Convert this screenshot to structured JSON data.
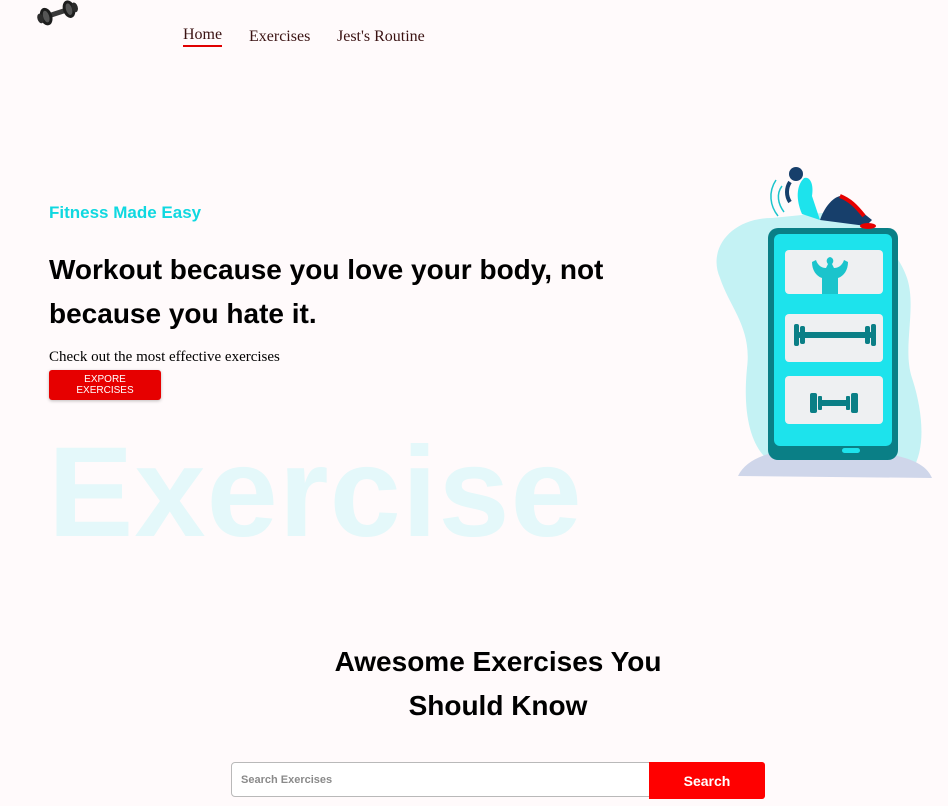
{
  "brand": {
    "logo_icon": "dumbbell-icon"
  },
  "nav": {
    "items": [
      {
        "label": "Home",
        "active": true
      },
      {
        "label": "Exercises"
      },
      {
        "label": "Jest's Routine"
      }
    ],
    "active_color": "#e00000"
  },
  "hero": {
    "tagline": "Fitness Made Easy",
    "headline": "Workout because you love your body, not because you hate it.",
    "subtext": "Check out the most effective exercises",
    "cta_label": "EXPORE EXERCISES",
    "watermark": "Exercise",
    "illustration_icon": "fitness-phone-illustration",
    "accent_color": "#10d8e0",
    "cta_color": "#e60000"
  },
  "exercises_section": {
    "title": "Awesome Exercises You Should Know"
  },
  "search": {
    "placeholder": "Search Exercises",
    "value": "",
    "button_label": "Search",
    "button_color": "#ff0000"
  }
}
